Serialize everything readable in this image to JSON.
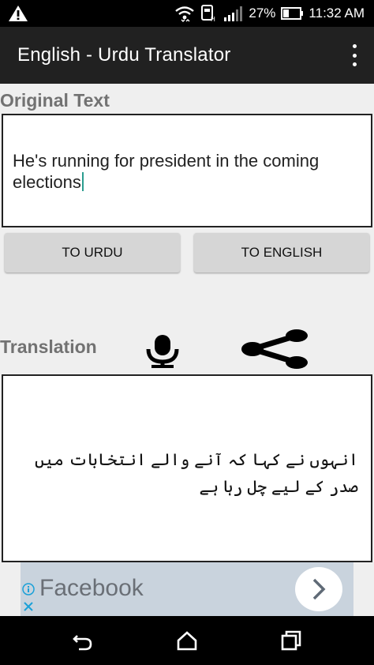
{
  "status_bar": {
    "icons": [
      "warning-icon",
      "wifi-icon",
      "sim-icon",
      "signal-icon",
      "battery-icon"
    ],
    "battery": "27%",
    "time": "11:32 AM"
  },
  "app_bar": {
    "title": "English - Urdu Translator",
    "menu_icon": "overflow-menu-icon"
  },
  "original": {
    "label": "Original Text",
    "input_value": "He's running for president in the coming elections"
  },
  "buttons": {
    "to_urdu": "TO URDU",
    "to_english": "TO ENGLISH"
  },
  "translation": {
    "label": "Translation",
    "icons": [
      "microphone-icon",
      "share-icon"
    ],
    "output_value": "انہوں نے کہا کہ آنے والے انتخابات میں صدر کے لیے چل رہا ہے"
  },
  "ad": {
    "text": "Facebook",
    "icons": [
      "ad-info-icon",
      "ad-close-icon",
      "chevron-right-icon"
    ]
  },
  "nav_bar": {
    "icons": [
      "back-icon",
      "home-icon",
      "recent-apps-icon"
    ]
  },
  "colors": {
    "app_bar": "#212121",
    "status_bar": "#000000",
    "background": "#efefef",
    "label": "#727272",
    "button": "#d6d6d6",
    "caret": "#2a9d8f",
    "ad_background": "#c9d3dd"
  }
}
